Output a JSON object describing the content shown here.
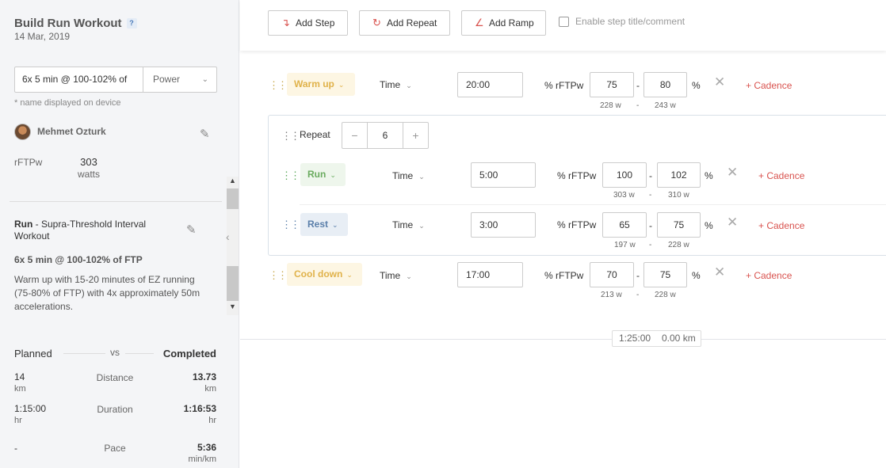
{
  "sidebar": {
    "title": "Build Run Workout",
    "help": "?",
    "date": "14 Mar, 2019",
    "name_value": "6x 5 min @ 100-102% of",
    "type_value": "Power",
    "name_note": "* name displayed on device",
    "user": "Mehmet Ozturk",
    "rftp_label": "rFTPw",
    "rftp_value": "303",
    "rftp_unit": "watts",
    "workout_title_bold": "Run",
    "workout_title_rest": " - Supra-Threshold Interval Workout",
    "workout_sub": "6x 5 min @ 100-102% of FTP",
    "workout_desc": "Warm up with 15-20 minutes of EZ running (75-80% of FTP) with 4x approximately 50m accelerations.",
    "compare": {
      "planned": "Planned",
      "vs": "vs",
      "completed": "Completed",
      "rows": [
        {
          "planned": "14",
          "planned_unit": "km",
          "label": "Distance",
          "completed": "13.73",
          "completed_unit": "km"
        },
        {
          "planned": "1:15:00",
          "planned_unit": "hr",
          "label": "Duration",
          "completed": "1:16:53",
          "completed_unit": "hr"
        },
        {
          "planned": "-",
          "planned_unit": "",
          "label": "Pace",
          "completed": "5:36",
          "completed_unit": "min/km"
        }
      ]
    }
  },
  "toolbar": {
    "add_step": "Add Step",
    "add_repeat": "Add Repeat",
    "add_ramp": "Add Ramp",
    "enable_title": "Enable step title/comment"
  },
  "steps": {
    "common": {
      "type": "Time",
      "ftp_label": "% rFTPw",
      "dash": "-",
      "pct": "%",
      "watts_dash": "-",
      "cadence": "+ Cadence"
    },
    "warmup": {
      "name": "Warm up",
      "duration": "20:00",
      "low": "75",
      "high": "80",
      "low_w": "228 w",
      "high_w": "243 w"
    },
    "repeat": {
      "label": "Repeat",
      "count": "6",
      "minus": "−",
      "plus": "+"
    },
    "run": {
      "name": "Run",
      "duration": "5:00",
      "low": "100",
      "high": "102",
      "low_w": "303 w",
      "high_w": "310 w"
    },
    "rest": {
      "name": "Rest",
      "duration": "3:00",
      "low": "65",
      "high": "75",
      "low_w": "197 w",
      "high_w": "228 w"
    },
    "cooldown": {
      "name": "Cool down",
      "duration": "17:00",
      "low": "70",
      "high": "75",
      "low_w": "213 w",
      "high_w": "228 w"
    }
  },
  "totals": {
    "time": "1:25:00",
    "distance": "0.00 km"
  },
  "colors": {
    "accent": "#d9534f",
    "warm": "#e0b24a",
    "run": "#6aab5f",
    "rest": "#5a7faa"
  }
}
